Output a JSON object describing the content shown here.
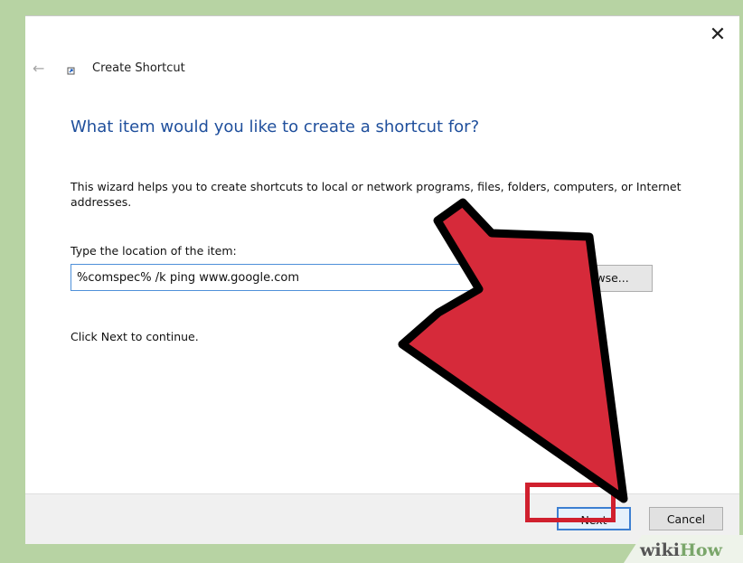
{
  "window": {
    "title": "Create Shortcut",
    "close_glyph": "✕",
    "back_glyph": "←"
  },
  "content": {
    "heading": "What item would you like to create a shortcut for?",
    "description": "This wizard helps you to create shortcuts to local or network programs, files, folders, computers, or Internet addresses.",
    "location_label": "Type the location of the item:",
    "location_value": "%comspec% /k ping www.google.com",
    "browse_label": "Browse...",
    "continue_text": "Click Next to continue."
  },
  "footer": {
    "next_label": "Next",
    "cancel_label": "Cancel"
  },
  "overlay": {
    "arrow_color": "#d62a3a",
    "highlight_color": "#d0202e",
    "watermark_text": "wikiHow"
  },
  "icons": {
    "back": "back-arrow-icon",
    "shortcut": "shortcut-icon",
    "close": "close-icon"
  }
}
